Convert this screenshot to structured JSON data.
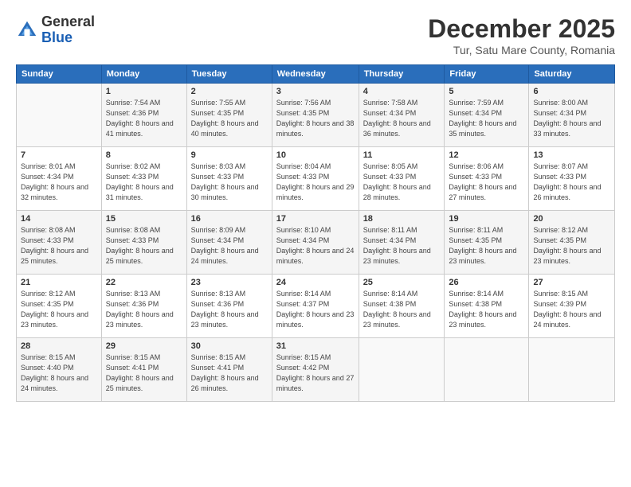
{
  "header": {
    "logo_line1": "General",
    "logo_line2": "Blue",
    "month_title": "December 2025",
    "subtitle": "Tur, Satu Mare County, Romania"
  },
  "weekdays": [
    "Sunday",
    "Monday",
    "Tuesday",
    "Wednesday",
    "Thursday",
    "Friday",
    "Saturday"
  ],
  "weeks": [
    [
      {
        "day": "",
        "info": ""
      },
      {
        "day": "1",
        "info": "Sunrise: 7:54 AM\nSunset: 4:36 PM\nDaylight: 8 hours\nand 41 minutes."
      },
      {
        "day": "2",
        "info": "Sunrise: 7:55 AM\nSunset: 4:35 PM\nDaylight: 8 hours\nand 40 minutes."
      },
      {
        "day": "3",
        "info": "Sunrise: 7:56 AM\nSunset: 4:35 PM\nDaylight: 8 hours\nand 38 minutes."
      },
      {
        "day": "4",
        "info": "Sunrise: 7:58 AM\nSunset: 4:34 PM\nDaylight: 8 hours\nand 36 minutes."
      },
      {
        "day": "5",
        "info": "Sunrise: 7:59 AM\nSunset: 4:34 PM\nDaylight: 8 hours\nand 35 minutes."
      },
      {
        "day": "6",
        "info": "Sunrise: 8:00 AM\nSunset: 4:34 PM\nDaylight: 8 hours\nand 33 minutes."
      }
    ],
    [
      {
        "day": "7",
        "info": "Sunrise: 8:01 AM\nSunset: 4:34 PM\nDaylight: 8 hours\nand 32 minutes."
      },
      {
        "day": "8",
        "info": "Sunrise: 8:02 AM\nSunset: 4:33 PM\nDaylight: 8 hours\nand 31 minutes."
      },
      {
        "day": "9",
        "info": "Sunrise: 8:03 AM\nSunset: 4:33 PM\nDaylight: 8 hours\nand 30 minutes."
      },
      {
        "day": "10",
        "info": "Sunrise: 8:04 AM\nSunset: 4:33 PM\nDaylight: 8 hours\nand 29 minutes."
      },
      {
        "day": "11",
        "info": "Sunrise: 8:05 AM\nSunset: 4:33 PM\nDaylight: 8 hours\nand 28 minutes."
      },
      {
        "day": "12",
        "info": "Sunrise: 8:06 AM\nSunset: 4:33 PM\nDaylight: 8 hours\nand 27 minutes."
      },
      {
        "day": "13",
        "info": "Sunrise: 8:07 AM\nSunset: 4:33 PM\nDaylight: 8 hours\nand 26 minutes."
      }
    ],
    [
      {
        "day": "14",
        "info": "Sunrise: 8:08 AM\nSunset: 4:33 PM\nDaylight: 8 hours\nand 25 minutes."
      },
      {
        "day": "15",
        "info": "Sunrise: 8:08 AM\nSunset: 4:33 PM\nDaylight: 8 hours\nand 25 minutes."
      },
      {
        "day": "16",
        "info": "Sunrise: 8:09 AM\nSunset: 4:34 PM\nDaylight: 8 hours\nand 24 minutes."
      },
      {
        "day": "17",
        "info": "Sunrise: 8:10 AM\nSunset: 4:34 PM\nDaylight: 8 hours\nand 24 minutes."
      },
      {
        "day": "18",
        "info": "Sunrise: 8:11 AM\nSunset: 4:34 PM\nDaylight: 8 hours\nand 23 minutes."
      },
      {
        "day": "19",
        "info": "Sunrise: 8:11 AM\nSunset: 4:35 PM\nDaylight: 8 hours\nand 23 minutes."
      },
      {
        "day": "20",
        "info": "Sunrise: 8:12 AM\nSunset: 4:35 PM\nDaylight: 8 hours\nand 23 minutes."
      }
    ],
    [
      {
        "day": "21",
        "info": "Sunrise: 8:12 AM\nSunset: 4:35 PM\nDaylight: 8 hours\nand 23 minutes."
      },
      {
        "day": "22",
        "info": "Sunrise: 8:13 AM\nSunset: 4:36 PM\nDaylight: 8 hours\nand 23 minutes."
      },
      {
        "day": "23",
        "info": "Sunrise: 8:13 AM\nSunset: 4:36 PM\nDaylight: 8 hours\nand 23 minutes."
      },
      {
        "day": "24",
        "info": "Sunrise: 8:14 AM\nSunset: 4:37 PM\nDaylight: 8 hours\nand 23 minutes."
      },
      {
        "day": "25",
        "info": "Sunrise: 8:14 AM\nSunset: 4:38 PM\nDaylight: 8 hours\nand 23 minutes."
      },
      {
        "day": "26",
        "info": "Sunrise: 8:14 AM\nSunset: 4:38 PM\nDaylight: 8 hours\nand 23 minutes."
      },
      {
        "day": "27",
        "info": "Sunrise: 8:15 AM\nSunset: 4:39 PM\nDaylight: 8 hours\nand 24 minutes."
      }
    ],
    [
      {
        "day": "28",
        "info": "Sunrise: 8:15 AM\nSunset: 4:40 PM\nDaylight: 8 hours\nand 24 minutes."
      },
      {
        "day": "29",
        "info": "Sunrise: 8:15 AM\nSunset: 4:41 PM\nDaylight: 8 hours\nand 25 minutes."
      },
      {
        "day": "30",
        "info": "Sunrise: 8:15 AM\nSunset: 4:41 PM\nDaylight: 8 hours\nand 26 minutes."
      },
      {
        "day": "31",
        "info": "Sunrise: 8:15 AM\nSunset: 4:42 PM\nDaylight: 8 hours\nand 27 minutes."
      },
      {
        "day": "",
        "info": ""
      },
      {
        "day": "",
        "info": ""
      },
      {
        "day": "",
        "info": ""
      }
    ]
  ]
}
